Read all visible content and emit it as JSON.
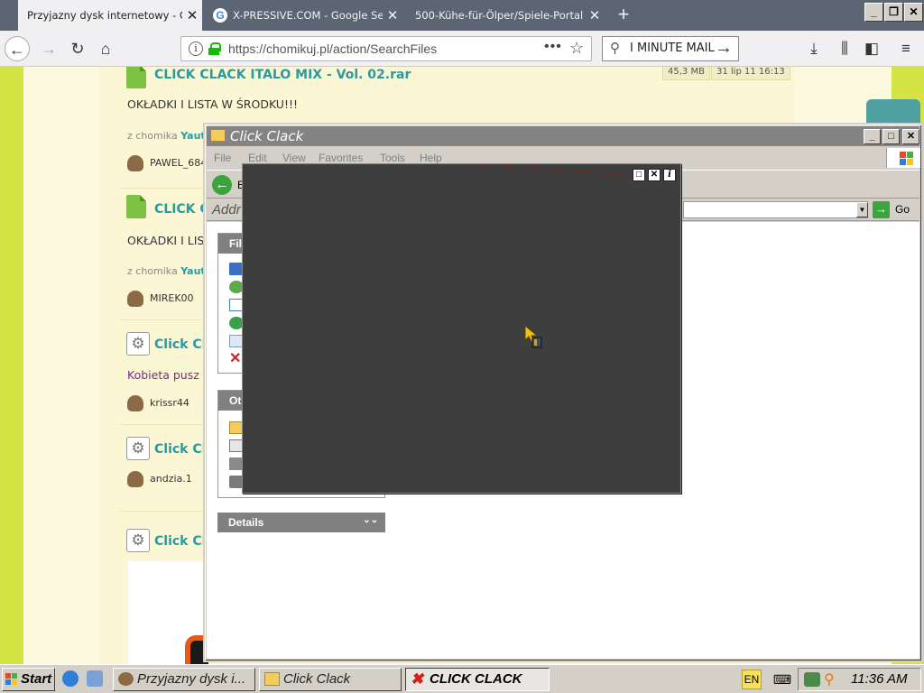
{
  "browser": {
    "tabs": [
      {
        "title": "Przyjazny dysk internetowy - Chomikuj.pl",
        "active": true
      },
      {
        "title": "X-PRESSIVE.COM - Google Search",
        "active": false
      },
      {
        "title": "500-Kühe-für-Ölper/Spiele-Portal",
        "active": false
      }
    ],
    "new_tab_glyph": "+",
    "url": "https://chomikuj.pl/action/SearchFiles",
    "search_text": "I MINUTE MAIL",
    "window_controls": {
      "minimize": "_",
      "restore": "❐",
      "close": "✕"
    }
  },
  "webpage": {
    "entries": [
      {
        "title": "CLICK CLACK ITALO MIX - Vol. 02.rar",
        "size": "45,3 MB",
        "date": "31 lip 11 16:13",
        "description": "OKŁADKI I LISTA W ŚRODKU!!!",
        "from_label": "z chomika",
        "from_user": "Yaut",
        "uploader": "PAWEL_684"
      },
      {
        "title": "CLICK C",
        "description": "OKŁADKI I LIS",
        "from_label": "z chomika",
        "from_user": "Yaut",
        "uploader": "MIREK00"
      },
      {
        "title": "Click Cla",
        "description": "Kobieta pusz",
        "uploader": "krissr44"
      },
      {
        "title": "Click Cla",
        "uploader": "andzia.1"
      },
      {
        "title": "Click Cla"
      }
    ]
  },
  "explorer": {
    "title": "Click Clack",
    "menu": [
      "File",
      "Edit",
      "View",
      "Favorites",
      "Tools",
      "Help"
    ],
    "back_label": "B",
    "address_label": "Addr",
    "go_label": "Go",
    "file_tasks_header": "File",
    "other_places_header": "Oth",
    "details_header": "Details"
  },
  "overlay": {
    "buttons": {
      "maximize": "□",
      "close": "✕",
      "info": "i"
    }
  },
  "taskbar": {
    "start_label": "Start",
    "tasks": [
      {
        "label": "Przyjazny dysk i...",
        "pressed": false
      },
      {
        "label": "Click Clack",
        "pressed": false
      },
      {
        "label": "CLICK CLACK",
        "pressed": true
      }
    ],
    "language": "EN",
    "clock": "11:36 AM"
  },
  "colors": {
    "page_accent": "#d6e344",
    "link_teal": "#2a9aa0",
    "xp_title_inactive": "#848484",
    "overlay_bg": "#3e3e3e"
  }
}
